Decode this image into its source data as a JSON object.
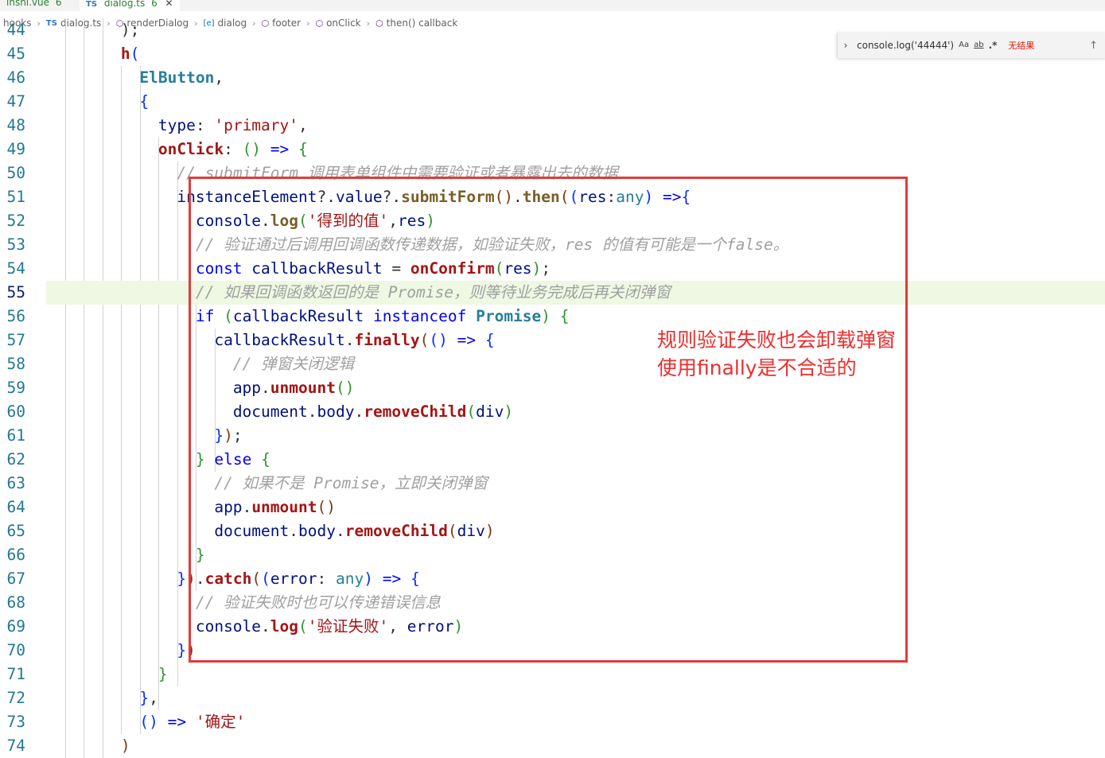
{
  "tabs": [
    {
      "name": "inshi.vue",
      "badge": "6"
    },
    {
      "name": "dialog.ts",
      "badge": "6",
      "active": true
    }
  ],
  "breadcrumb": [
    {
      "label": "hooks",
      "icon": ""
    },
    {
      "label": "dialog.ts",
      "icon": "ts"
    },
    {
      "label": "renderDialog",
      "icon": "cube"
    },
    {
      "label": "dialog",
      "icon": "var"
    },
    {
      "label": "footer",
      "icon": "cube"
    },
    {
      "label": "onClick",
      "icon": "cube"
    },
    {
      "label": "then() callback",
      "icon": "cube"
    }
  ],
  "find_widget": {
    "query": "console.log('44444')",
    "match_case": "Aa",
    "whole_word": "ab",
    "regex": ".*",
    "result": "无结果"
  },
  "editor": {
    "active_line": 55,
    "lines": [
      {
        "n": "44",
        "tokens": [
          [
            "p",
            "        );"
          ]
        ]
      },
      {
        "n": "45",
        "tokens": [
          [
            "p",
            "        "
          ],
          [
            "fn",
            "h"
          ],
          [
            "b1",
            "("
          ]
        ]
      },
      {
        "n": "46",
        "tokens": [
          [
            "p",
            "          "
          ],
          [
            "cls",
            "ElButton"
          ],
          [
            "p",
            ","
          ]
        ]
      },
      {
        "n": "47",
        "tokens": [
          [
            "p",
            "          "
          ],
          [
            "b1",
            "{"
          ]
        ]
      },
      {
        "n": "48",
        "tokens": [
          [
            "p",
            "            "
          ],
          [
            "v",
            "type"
          ],
          [
            "p",
            ": "
          ],
          [
            "s",
            "'primary'"
          ],
          [
            "p",
            ","
          ]
        ]
      },
      {
        "n": "49",
        "tokens": [
          [
            "p",
            "            "
          ],
          [
            "fn",
            "onClick"
          ],
          [
            "p",
            ": "
          ],
          [
            "b2",
            "()"
          ],
          [
            "p",
            " "
          ],
          [
            "k",
            "=>"
          ],
          [
            "p",
            " "
          ],
          [
            "b2",
            "{"
          ]
        ]
      },
      {
        "n": "50",
        "tokens": [
          [
            "p",
            "              "
          ],
          [
            "c",
            "// submitForm 调用表单组件中需要验证或者暴露出去的数据"
          ]
        ]
      },
      {
        "n": "51",
        "tokens": [
          [
            "p",
            "              "
          ],
          [
            "v",
            "instanceElement"
          ],
          [
            "p",
            "?."
          ],
          [
            "v",
            "value"
          ],
          [
            "p",
            "?."
          ],
          [
            "f",
            "submitForm"
          ],
          [
            "b3",
            "()"
          ],
          [
            "p",
            "."
          ],
          [
            "f",
            "then"
          ],
          [
            "b3",
            "("
          ],
          [
            "b1",
            "("
          ],
          [
            "v",
            "res"
          ],
          [
            "p",
            ":"
          ],
          [
            "t",
            "any"
          ],
          [
            "b1",
            ")"
          ],
          [
            "p",
            " "
          ],
          [
            "k",
            "=>"
          ],
          [
            "b1",
            "{"
          ]
        ]
      },
      {
        "n": "52",
        "tokens": [
          [
            "p",
            "                "
          ],
          [
            "v",
            "console"
          ],
          [
            "p",
            "."
          ],
          [
            "f",
            "log"
          ],
          [
            "b2",
            "("
          ],
          [
            "s",
            "'得到的值'"
          ],
          [
            "p",
            ","
          ],
          [
            "v",
            "res"
          ],
          [
            "b2",
            ")"
          ]
        ]
      },
      {
        "n": "53",
        "tokens": [
          [
            "p",
            "                "
          ],
          [
            "c",
            "// 验证通过后调用回调函数传递数据，如验证失败，res 的值有可能是一个false。"
          ]
        ]
      },
      {
        "n": "54",
        "tokens": [
          [
            "p",
            "                "
          ],
          [
            "k",
            "const"
          ],
          [
            "p",
            " "
          ],
          [
            "v",
            "callbackResult"
          ],
          [
            "p",
            " = "
          ],
          [
            "fn",
            "onConfirm"
          ],
          [
            "b2",
            "("
          ],
          [
            "v",
            "res"
          ],
          [
            "b2",
            ")"
          ],
          [
            "p",
            ";"
          ]
        ]
      },
      {
        "n": "55",
        "tokens": [
          [
            "p",
            "                "
          ],
          [
            "c",
            "// 如果回调函数返回的是 Promise，则等待业务完成后再关闭弹窗"
          ]
        ]
      },
      {
        "n": "56",
        "tokens": [
          [
            "p",
            "                "
          ],
          [
            "k",
            "if"
          ],
          [
            "p",
            " "
          ],
          [
            "b2",
            "("
          ],
          [
            "v",
            "callbackResult"
          ],
          [
            "p",
            " "
          ],
          [
            "k",
            "instanceof"
          ],
          [
            "p",
            " "
          ],
          [
            "cls",
            "Promise"
          ],
          [
            "b2",
            ")"
          ],
          [
            "p",
            " "
          ],
          [
            "b2",
            "{"
          ]
        ]
      },
      {
        "n": "57",
        "tokens": [
          [
            "p",
            "                  "
          ],
          [
            "v",
            "callbackResult"
          ],
          [
            "p",
            "."
          ],
          [
            "fn",
            "finally"
          ],
          [
            "b3",
            "("
          ],
          [
            "b1",
            "()"
          ],
          [
            "p",
            " "
          ],
          [
            "k",
            "=>"
          ],
          [
            "p",
            " "
          ],
          [
            "b1",
            "{"
          ]
        ]
      },
      {
        "n": "58",
        "tokens": [
          [
            "p",
            "                    "
          ],
          [
            "c",
            "// 弹窗关闭逻辑"
          ]
        ]
      },
      {
        "n": "59",
        "tokens": [
          [
            "p",
            "                    "
          ],
          [
            "v",
            "app"
          ],
          [
            "p",
            "."
          ],
          [
            "fn",
            "unmount"
          ],
          [
            "b2",
            "()"
          ]
        ]
      },
      {
        "n": "60",
        "tokens": [
          [
            "p",
            "                    "
          ],
          [
            "v",
            "document"
          ],
          [
            "p",
            "."
          ],
          [
            "v",
            "body"
          ],
          [
            "p",
            "."
          ],
          [
            "fn",
            "removeChild"
          ],
          [
            "b2",
            "("
          ],
          [
            "v",
            "div"
          ],
          [
            "b2",
            ")"
          ]
        ]
      },
      {
        "n": "61",
        "tokens": [
          [
            "p",
            "                  "
          ],
          [
            "b1",
            "}"
          ],
          [
            "b3",
            ")"
          ],
          [
            "p",
            ";"
          ]
        ]
      },
      {
        "n": "62",
        "tokens": [
          [
            "p",
            "                "
          ],
          [
            "b2",
            "}"
          ],
          [
            "p",
            " "
          ],
          [
            "k",
            "else"
          ],
          [
            "p",
            " "
          ],
          [
            "b2",
            "{"
          ]
        ]
      },
      {
        "n": "63",
        "tokens": [
          [
            "p",
            "                  "
          ],
          [
            "c",
            "// 如果不是 Promise，立即关闭弹窗"
          ]
        ]
      },
      {
        "n": "64",
        "tokens": [
          [
            "p",
            "                  "
          ],
          [
            "v",
            "app"
          ],
          [
            "p",
            "."
          ],
          [
            "fn",
            "unmount"
          ],
          [
            "b3",
            "()"
          ]
        ]
      },
      {
        "n": "65",
        "tokens": [
          [
            "p",
            "                  "
          ],
          [
            "v",
            "document"
          ],
          [
            "p",
            "."
          ],
          [
            "v",
            "body"
          ],
          [
            "p",
            "."
          ],
          [
            "fn",
            "removeChild"
          ],
          [
            "b3",
            "("
          ],
          [
            "v",
            "div"
          ],
          [
            "b3",
            ")"
          ]
        ]
      },
      {
        "n": "66",
        "tokens": [
          [
            "p",
            "                "
          ],
          [
            "b2",
            "}"
          ]
        ]
      },
      {
        "n": "67",
        "tokens": [
          [
            "p",
            "              "
          ],
          [
            "b1",
            "}"
          ],
          [
            "b3",
            ")"
          ],
          [
            "p",
            "."
          ],
          [
            "fn",
            "catch"
          ],
          [
            "b3",
            "("
          ],
          [
            "b1",
            "("
          ],
          [
            "v",
            "error"
          ],
          [
            "p",
            ": "
          ],
          [
            "t",
            "any"
          ],
          [
            "b1",
            ")"
          ],
          [
            "p",
            " "
          ],
          [
            "k",
            "=>"
          ],
          [
            "p",
            " "
          ],
          [
            "b1",
            "{"
          ]
        ]
      },
      {
        "n": "68",
        "tokens": [
          [
            "p",
            "                "
          ],
          [
            "c",
            "// 验证失败时也可以传递错误信息"
          ]
        ]
      },
      {
        "n": "69",
        "tokens": [
          [
            "p",
            "                "
          ],
          [
            "v",
            "console"
          ],
          [
            "p",
            "."
          ],
          [
            "fn",
            "log"
          ],
          [
            "b2",
            "("
          ],
          [
            "s",
            "'验证失败'"
          ],
          [
            "p",
            ", "
          ],
          [
            "v",
            "error"
          ],
          [
            "b2",
            ")"
          ]
        ]
      },
      {
        "n": "70",
        "tokens": [
          [
            "p",
            "              "
          ],
          [
            "b1",
            "}"
          ],
          [
            "b3",
            ")"
          ]
        ]
      },
      {
        "n": "71",
        "tokens": [
          [
            "p",
            "            "
          ],
          [
            "b2",
            "}"
          ]
        ]
      },
      {
        "n": "72",
        "tokens": [
          [
            "p",
            "          "
          ],
          [
            "b1",
            "}"
          ],
          [
            "p",
            ","
          ]
        ]
      },
      {
        "n": "73",
        "tokens": [
          [
            "p",
            "          "
          ],
          [
            "b1",
            "()"
          ],
          [
            "p",
            " "
          ],
          [
            "k",
            "=>"
          ],
          [
            "p",
            " "
          ],
          [
            "s",
            "'确定'"
          ]
        ]
      },
      {
        "n": "74",
        "tokens": [
          [
            "p",
            "        "
          ],
          [
            "b3",
            ")"
          ]
        ]
      }
    ]
  },
  "annotation": {
    "line1": "规则验证失败也会卸载弹窗",
    "line2": "使用finally是不合适的",
    "color": "#e03b3b"
  }
}
